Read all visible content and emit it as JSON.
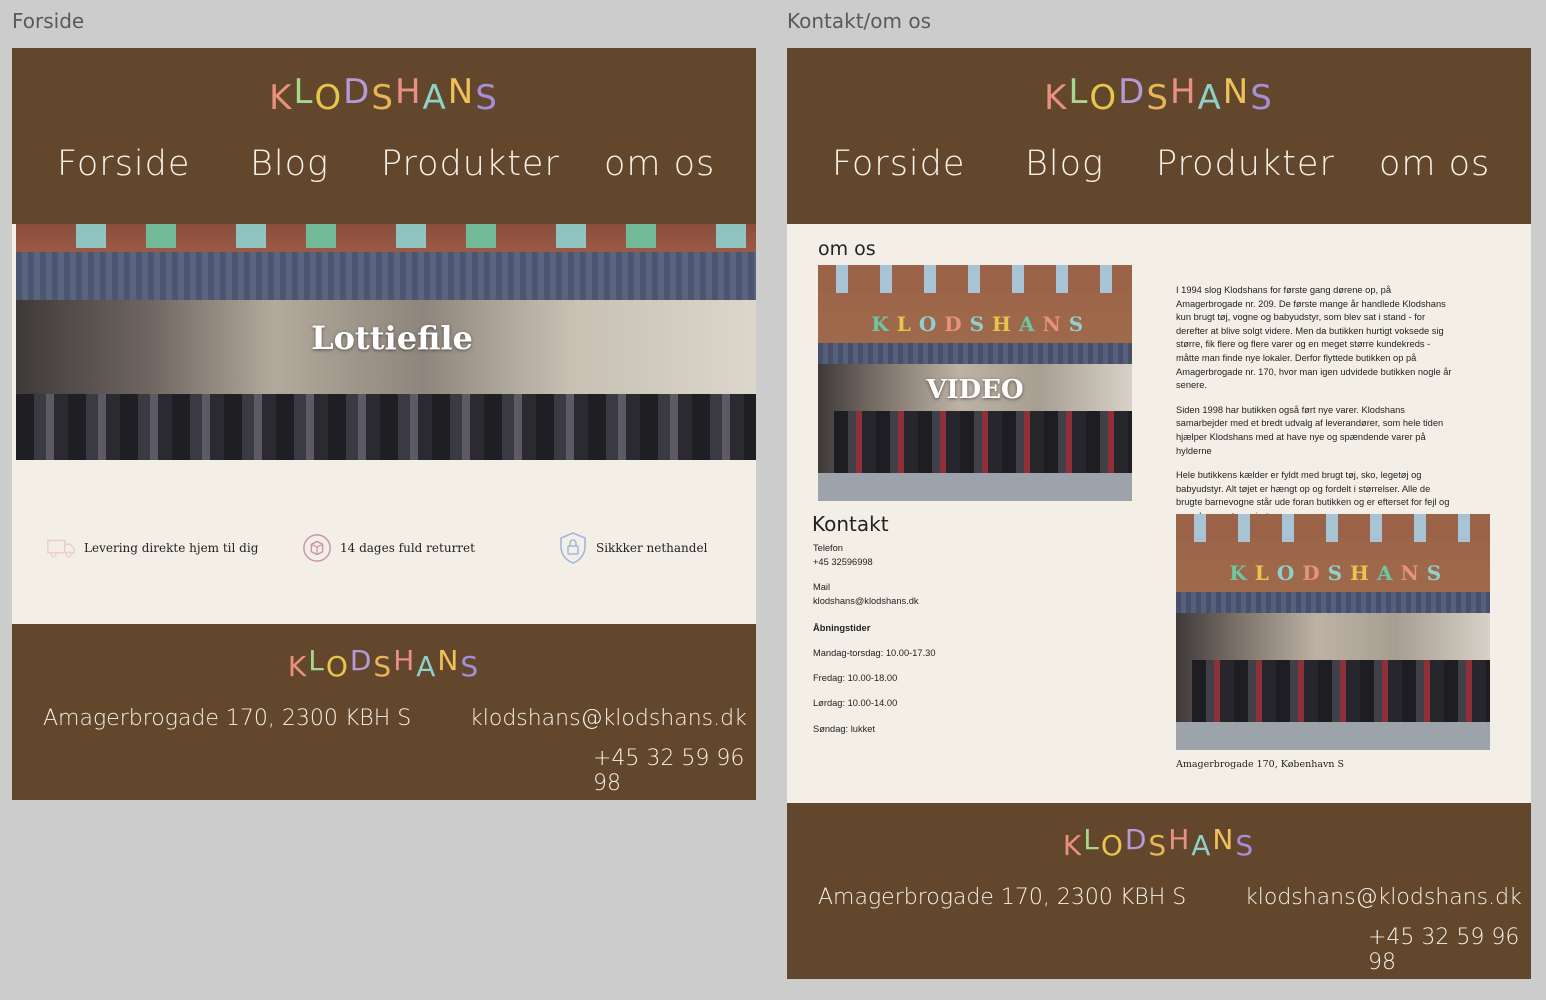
{
  "frames": {
    "home_label": "Forside",
    "contact_label": "Kontakt/om os"
  },
  "logo": {
    "letters": [
      "K",
      "L",
      "O",
      "D",
      "S",
      "H",
      "A",
      "N",
      "S"
    ],
    "colors": [
      "#e8927d",
      "#a7d68d",
      "#e7c64c",
      "#b59ad6",
      "#e8b458",
      "#e88f86",
      "#8fd0c8",
      "#f0c15a",
      "#a58fd6"
    ]
  },
  "nav": {
    "items": [
      "Forside",
      "Blog",
      "Produkter",
      "om os"
    ]
  },
  "home": {
    "hero_title": "Lottiefile",
    "features": [
      {
        "label": "Levering direkte hjem til dig",
        "icon": "truck-icon"
      },
      {
        "label": "14 dages fuld returret",
        "icon": "return-box-icon"
      },
      {
        "label": "Sikkker nethandel",
        "icon": "shield-lock-icon"
      }
    ]
  },
  "footer": {
    "address": "Amagerbrogade 170, 2300 KBH S",
    "email": "klodshans@klodshans.dk",
    "phone": "+45 32 59 96 98"
  },
  "contact": {
    "om_heading": "om os",
    "video_label": "VIDEO",
    "about_paragraphs": [
      "I 1994 slog Klodshans for første gang dørene op, på Amagerbrogade nr. 209. De første mange år handlede Klodshans kun brugt tøj, vogne og babyudstyr, som blev sat i stand - for derefter at blive solgt videre. Men da butikken hurtigt voksede sig større, fik flere og flere varer og en meget større kundekreds - måtte man finde nye lokaler. Derfor flyttede butikken op på Amagerbrogade nr. 170, hvor man igen udvidede butikken nogle år senere.",
      "Siden 1998 har butikken også ført nye varer. Klodshans samarbejder med et bredt udvalg af leverandører, som hele tiden hjælper Klodshans med at have nye og spændende varer på hylderne",
      "Hele butikkens kælder er fyldt med brugt tøj, sko, legetøj og babyudstyr. Alt tøjet er hængt op og fordelt i størrelser. Alle de brugte barnevogne står ude foran butikken og er efterset for fejl og mangler, samt rengjorte."
    ],
    "kontakt_heading": "Kontakt",
    "phone_label": "Telefon",
    "phone_value": "+45 32596998",
    "mail_label": "Mail",
    "mail_value": "klodshans@klodshans.dk",
    "hours_heading": "Åbningstider",
    "hours": [
      "Mandag-torsdag: 10.00-17.30",
      "Fredag: 10.00-18.00",
      "Lørdag: 10.00-14.00",
      "Søndag: lukket"
    ],
    "photo_caption": "Amagerbrogade 170, København S"
  },
  "sign_letters": [
    "K",
    "L",
    "O",
    "D",
    "S",
    "H",
    "A",
    "N",
    "S"
  ],
  "sign_colors": [
    "#6ec6a2",
    "#e7c64c",
    "#8fd0cf",
    "#e8927d",
    "#8fd0cf",
    "#e7c64c",
    "#6ec6a2",
    "#e8927d",
    "#8fd0cf"
  ]
}
